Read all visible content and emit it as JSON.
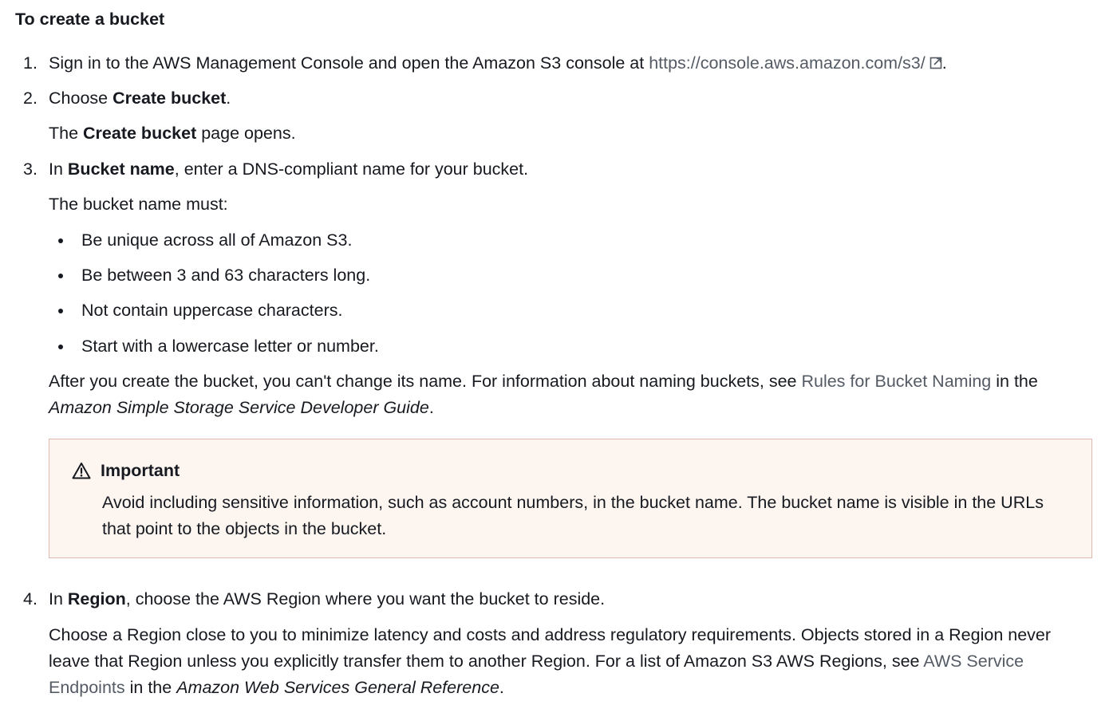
{
  "title": "To create a bucket",
  "step1": {
    "num": "1.",
    "text_before": "Sign in to the AWS Management Console and open the Amazon S3 console at ",
    "link": "https://console.aws.amazon.com/s3/",
    "text_after": "."
  },
  "step2": {
    "num": "2.",
    "pre": "Choose ",
    "bold": "Create bucket",
    "post": ".",
    "sub_pre": "The ",
    "sub_bold": "Create bucket",
    "sub_post": " page opens."
  },
  "step3": {
    "num": "3.",
    "pre": "In ",
    "bold": "Bucket name",
    "post": ", enter a DNS-compliant name for your bucket.",
    "must": "The bucket name must:",
    "bullets": [
      "Be unique across all of Amazon S3.",
      "Be between 3 and 63 characters long.",
      "Not contain uppercase characters.",
      "Start with a lowercase letter or number."
    ],
    "after_pre": "After you create the bucket, you can't change its name. For information about naming buckets, see ",
    "after_link": "Rules for Bucket Naming",
    "after_mid": " in the",
    "after_italic": "Amazon Simple Storage Service Developer Guide",
    "after_end": "."
  },
  "callout": {
    "title": "Important",
    "text": "Avoid including sensitive information, such as account numbers, in the bucket name. The bucket name is visible in the URLs that point to the objects in the bucket.",
    "icon": "warning-triangle-icon"
  },
  "step4": {
    "num": "4.",
    "pre": "In ",
    "bold": "Region",
    "post": ", choose the AWS Region where you want the bucket to reside.",
    "p1": "Choose a Region close to you to minimize latency and costs and address regulatory requirements. Objects stored in a Region never",
    "p2_pre": "leave that Region unless you explicitly transfer them to another Region. For a list of Amazon S3 AWS Regions, see ",
    "p2_link": "AWS Service",
    "p3_link": "Endpoints",
    "p3_mid": " in the ",
    "p3_italic": "Amazon Web Services General Reference",
    "p3_end": "."
  },
  "colors": {
    "text": "#16191f",
    "link": "#545b64",
    "callout_bg": "#fcf5f0",
    "callout_border": "#dfb8b0"
  }
}
